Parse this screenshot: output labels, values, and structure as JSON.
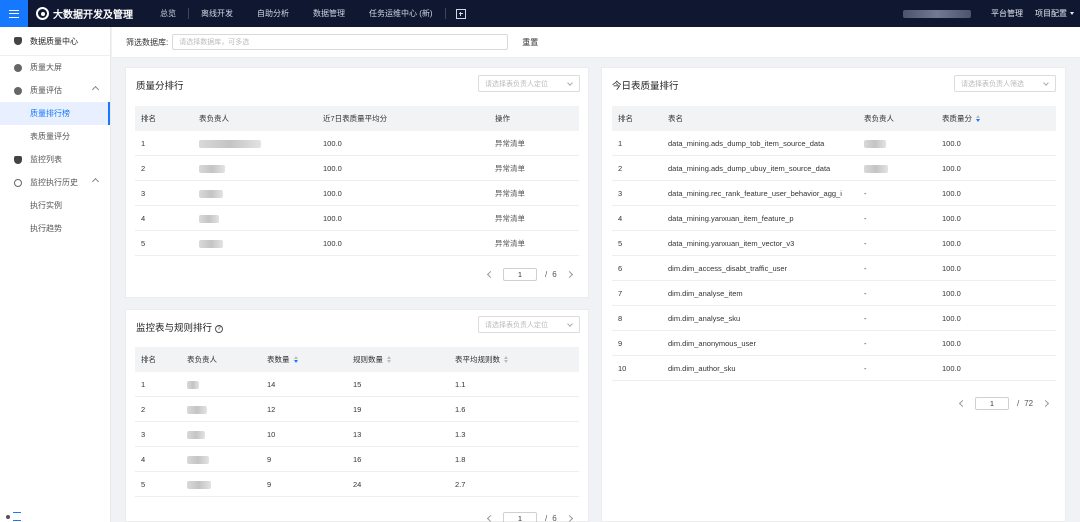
{
  "header": {
    "brand": "大数据开发及管理",
    "nav": [
      "总览",
      "离线开发",
      "自助分析",
      "数据管理",
      "任务运维中心 (新)"
    ],
    "right": {
      "platform": "平台管理",
      "project": "项目配置"
    }
  },
  "sidebar": {
    "title": "数据质量中心",
    "items": [
      {
        "label": "质量大屏"
      },
      {
        "label": "质量评估"
      },
      {
        "label": "质量排行榜"
      },
      {
        "label": "表质量评分"
      },
      {
        "label": "监控列表"
      },
      {
        "label": "监控执行历史"
      },
      {
        "label": "执行实例"
      },
      {
        "label": "执行趋势"
      }
    ]
  },
  "filter": {
    "label": "筛选数据库:",
    "placeholder": "请选择数据库，可多选",
    "reset": "重置"
  },
  "colors": {
    "accent": "#1677ff",
    "topbar": "#0f1731"
  },
  "quality_rank": {
    "title": "质量分排行",
    "select_placeholder": "请选择表负责人定位",
    "columns": [
      "排名",
      "表负责人",
      "近7日表质量平均分",
      "操作"
    ],
    "rows": [
      {
        "rank": "1",
        "score": "100.0",
        "action": "异常清单"
      },
      {
        "rank": "2",
        "score": "100.0",
        "action": "异常清单"
      },
      {
        "rank": "3",
        "score": "100.0",
        "action": "异常清单"
      },
      {
        "rank": "4",
        "score": "100.0",
        "action": "异常清单"
      },
      {
        "rank": "5",
        "score": "100.0",
        "action": "异常清单"
      }
    ],
    "pager": {
      "page": "1",
      "total": "6"
    }
  },
  "monitor_rank": {
    "title": "监控表与规则排行",
    "select_placeholder": "请选择表负责人定位",
    "columns": [
      "排名",
      "表负责人",
      "表数量",
      "规则数量",
      "表平均规则数"
    ],
    "rows": [
      {
        "rank": "1",
        "tables": "14",
        "rules": "15",
        "avg": "1.1"
      },
      {
        "rank": "2",
        "tables": "12",
        "rules": "19",
        "avg": "1.6"
      },
      {
        "rank": "3",
        "tables": "10",
        "rules": "13",
        "avg": "1.3"
      },
      {
        "rank": "4",
        "tables": "9",
        "rules": "16",
        "avg": "1.8"
      },
      {
        "rank": "5",
        "tables": "9",
        "rules": "24",
        "avg": "2.7"
      }
    ],
    "pager": {
      "page": "1",
      "total": "6"
    }
  },
  "today_rank": {
    "title": "今日表质量排行",
    "select_placeholder": "请选择表负责人筛选",
    "columns": [
      "排名",
      "表名",
      "表负责人",
      "表质量分"
    ],
    "rows": [
      {
        "rank": "1",
        "name": "data_mining.ads_dump_tob_item_source_data",
        "owner": "",
        "score": "100.0"
      },
      {
        "rank": "2",
        "name": "data_mining.ads_dump_ubuy_item_source_data",
        "owner": "",
        "score": "100.0"
      },
      {
        "rank": "3",
        "name": "data_mining.rec_rank_feature_user_behavior_agg_i",
        "owner": "-",
        "score": "100.0"
      },
      {
        "rank": "4",
        "name": "data_mining.yanxuan_item_feature_p",
        "owner": "-",
        "score": "100.0"
      },
      {
        "rank": "5",
        "name": "data_mining.yanxuan_item_vector_v3",
        "owner": "-",
        "score": "100.0"
      },
      {
        "rank": "6",
        "name": "dim.dim_access_disabt_traffic_user",
        "owner": "-",
        "score": "100.0"
      },
      {
        "rank": "7",
        "name": "dim.dim_analyse_item",
        "owner": "-",
        "score": "100.0"
      },
      {
        "rank": "8",
        "name": "dim.dim_analyse_sku",
        "owner": "-",
        "score": "100.0"
      },
      {
        "rank": "9",
        "name": "dim.dim_anonymous_user",
        "owner": "-",
        "score": "100.0"
      },
      {
        "rank": "10",
        "name": "dim.dim_author_sku",
        "owner": "-",
        "score": "100.0"
      }
    ],
    "pager": {
      "page": "1",
      "total": "72"
    }
  }
}
